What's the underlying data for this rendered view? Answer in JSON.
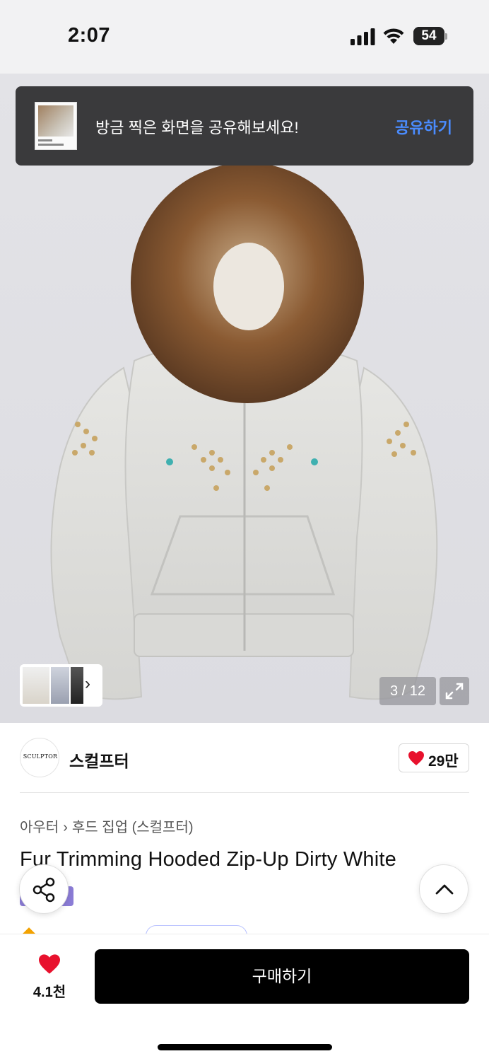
{
  "status_bar": {
    "time": "2:07",
    "battery": "54",
    "battery_level": 0.54
  },
  "toast": {
    "message": "방금 찍은 화면을 공유해보세요!",
    "action_label": "공유하기"
  },
  "gallery": {
    "counter": "3 / 12",
    "thumbnail_icon": "chevron-right-icon",
    "expand_icon": "expand-icon"
  },
  "brand": {
    "logo_text": "SCULPTOR",
    "name": "스컬프터",
    "likes": "29만"
  },
  "breadcrumb": {
    "level1": "아우터",
    "separator": "›",
    "level2": "후드 집업 (스컬프터)"
  },
  "product": {
    "title": "Fur Trimming Hooded Zip-Up Dirty White"
  },
  "bottom_bar": {
    "favorite_count": "4.1천",
    "buy_label": "구매하기"
  },
  "colors": {
    "accent_blue": "#4a8cff",
    "heart_red": "#e8112d",
    "buy_button": "#000000",
    "toast_bg": "#3a3a3c"
  }
}
